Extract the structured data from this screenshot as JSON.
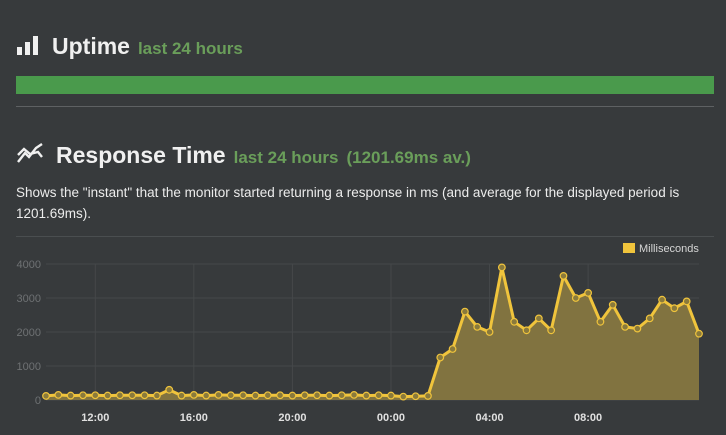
{
  "uptime": {
    "title": "Uptime",
    "period": "last 24 hours",
    "bar_color": "#4a9a4c",
    "icon": "bar-chart-icon"
  },
  "response": {
    "title": "Response Time",
    "period": "last 24 hours",
    "average_label": "(1201.69ms av.)",
    "description": "Shows the \"instant\" that the monitor started returning a response in ms (and average for the displayed period is 1201.69ms).",
    "icon": "line-chart-icon"
  },
  "chart_data": {
    "type": "area",
    "legend": {
      "label": "Milliseconds",
      "position": "top-right",
      "color": "#f0c43c"
    },
    "ylim": [
      0,
      4000
    ],
    "y_ticks": [
      0,
      1000,
      2000,
      3000,
      4000
    ],
    "x_ticks": [
      "12:00",
      "16:00",
      "20:00",
      "00:00",
      "04:00",
      "08:00"
    ],
    "x_tick_index": [
      4,
      12,
      20,
      28,
      36,
      44
    ],
    "series": [
      {
        "name": "Milliseconds",
        "values": [
          120,
          150,
          130,
          140,
          140,
          130,
          140,
          140,
          140,
          130,
          300,
          130,
          150,
          130,
          150,
          140,
          140,
          130,
          140,
          140,
          130,
          140,
          140,
          130,
          140,
          150,
          130,
          140,
          130,
          100,
          110,
          120,
          1250,
          1500,
          2600,
          2150,
          2000,
          3900,
          2300,
          2050,
          2400,
          2050,
          3650,
          3000,
          3150,
          2300,
          2800,
          2150,
          2100,
          2400,
          2950,
          2700,
          2900,
          1950
        ]
      }
    ],
    "grid": true
  }
}
